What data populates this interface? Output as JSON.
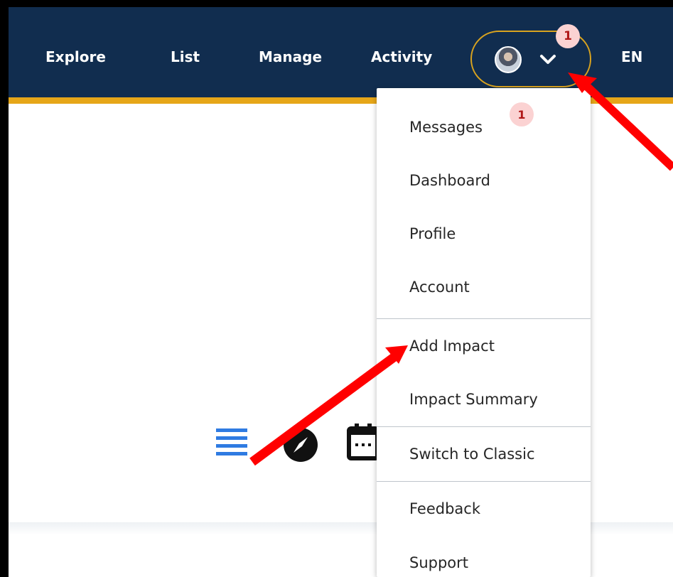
{
  "nav": {
    "explore": "Explore",
    "list": "List",
    "manage": "Manage",
    "activity": "Activity",
    "language": "EN",
    "notification_count": "1"
  },
  "menu": {
    "messages": "Messages",
    "messages_badge": "1",
    "dashboard": "Dashboard",
    "profile": "Profile",
    "account": "Account",
    "add_impact": "Add Impact",
    "impact_summary": "Impact Summary",
    "switch_to_classic": "Switch to Classic",
    "feedback": "Feedback",
    "support": "Support"
  },
  "colors": {
    "navbar": "#112d4f",
    "accent": "#e6a619",
    "badge_bg": "#fbd2d2",
    "badge_text": "#b01818",
    "arrow": "#ff0000",
    "list_icon": "#2f7be2"
  },
  "icons": [
    "list-icon",
    "compass-icon",
    "calendar-icon",
    "chevron-down-icon",
    "avatar"
  ]
}
